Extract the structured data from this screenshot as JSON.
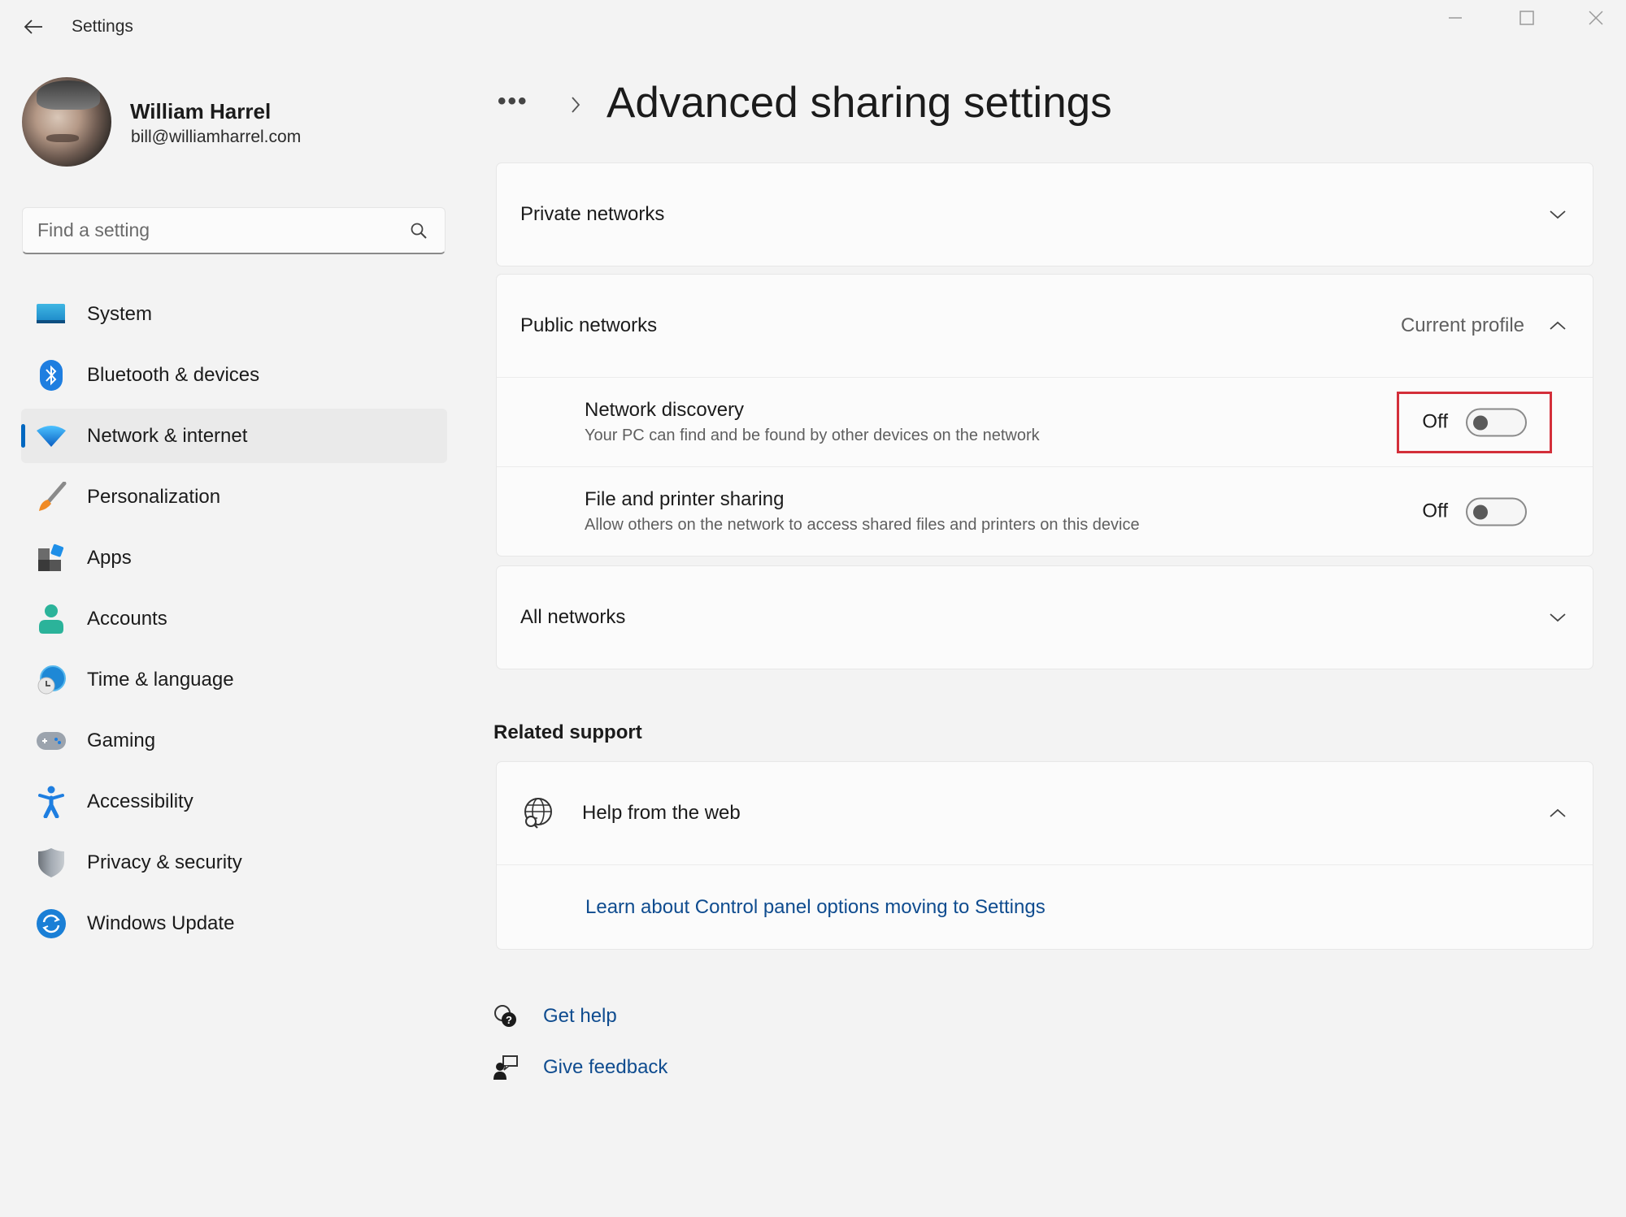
{
  "window": {
    "title": "Settings",
    "controls": {
      "minimize": "minimize-icon",
      "maximize": "maximize-icon",
      "close": "close-icon"
    }
  },
  "profile": {
    "name": "William Harrel",
    "email": "bill@williamharrel.com"
  },
  "search": {
    "placeholder": "Find a setting",
    "value": ""
  },
  "sidebar": {
    "items": [
      {
        "label": "System",
        "icon": "monitor-icon",
        "selected": false
      },
      {
        "label": "Bluetooth & devices",
        "icon": "bluetooth-icon",
        "selected": false
      },
      {
        "label": "Network & internet",
        "icon": "wifi-icon",
        "selected": true
      },
      {
        "label": "Personalization",
        "icon": "paintbrush-icon",
        "selected": false
      },
      {
        "label": "Apps",
        "icon": "apps-icon",
        "selected": false
      },
      {
        "label": "Accounts",
        "icon": "person-icon",
        "selected": false
      },
      {
        "label": "Time & language",
        "icon": "globe-clock-icon",
        "selected": false
      },
      {
        "label": "Gaming",
        "icon": "gamepad-icon",
        "selected": false
      },
      {
        "label": "Accessibility",
        "icon": "accessibility-icon",
        "selected": false
      },
      {
        "label": "Privacy & security",
        "icon": "shield-icon",
        "selected": false
      },
      {
        "label": "Windows Update",
        "icon": "refresh-icon",
        "selected": false
      }
    ]
  },
  "breadcrumb": {
    "more": "•••",
    "title": "Advanced sharing settings"
  },
  "sections": {
    "private": {
      "title": "Private networks",
      "expanded": false
    },
    "public": {
      "title": "Public networks",
      "extra": "Current profile",
      "expanded": true,
      "settings": [
        {
          "title": "Network discovery",
          "description": "Your PC can find and be found by other devices on the network",
          "state": "Off",
          "on": false,
          "highlighted": true
        },
        {
          "title": "File and printer sharing",
          "description": "Allow others on the network to access shared files and printers on this device",
          "state": "Off",
          "on": false,
          "highlighted": false
        }
      ]
    },
    "all": {
      "title": "All networks",
      "expanded": false
    }
  },
  "related_support": {
    "heading": "Related support",
    "help_from_web": {
      "title": "Help from the web",
      "expanded": true,
      "links": [
        "Learn about Control panel options moving to Settings"
      ]
    }
  },
  "footer": {
    "get_help": "Get help",
    "give_feedback": "Give feedback"
  },
  "colors": {
    "accent": "#0067c0",
    "link": "#0f4c8f",
    "highlight": "#d32f3a",
    "background": "#f3f3f3",
    "card": "#fbfbfb"
  }
}
